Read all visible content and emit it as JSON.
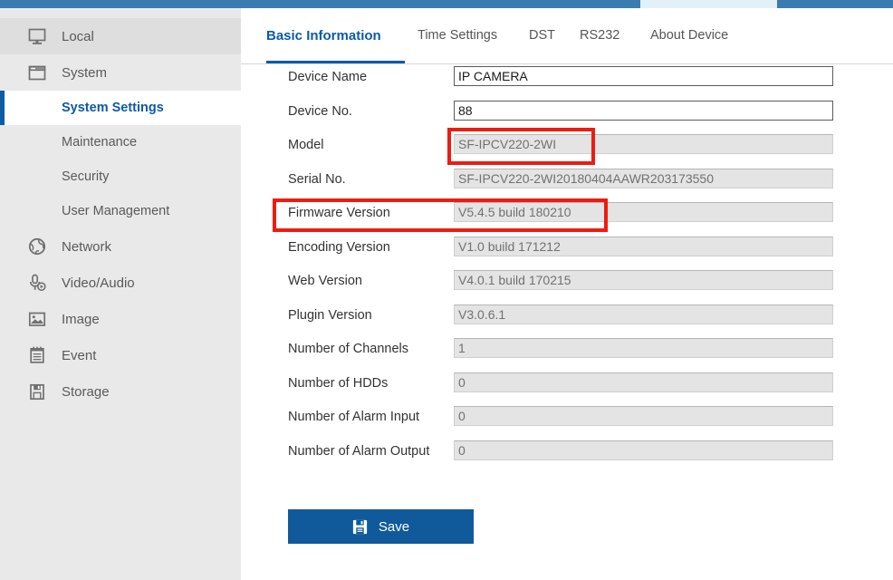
{
  "topbar": {
    "active_tab_placeholder": ""
  },
  "sidebar": {
    "items": [
      {
        "label": "Local",
        "icon": "monitor-icon",
        "level": "top",
        "state": "hover"
      },
      {
        "label": "System",
        "icon": "window-icon",
        "level": "top",
        "state": "expanded"
      },
      {
        "label": "System Settings",
        "icon": "",
        "level": "sub",
        "state": "active"
      },
      {
        "label": "Maintenance",
        "icon": "",
        "level": "sub",
        "state": "normal"
      },
      {
        "label": "Security",
        "icon": "",
        "level": "sub",
        "state": "normal"
      },
      {
        "label": "User Management",
        "icon": "",
        "level": "sub",
        "state": "normal"
      },
      {
        "label": "Network",
        "icon": "globe-icon",
        "level": "top",
        "state": "normal"
      },
      {
        "label": "Video/Audio",
        "icon": "microphone-icon",
        "level": "top",
        "state": "normal"
      },
      {
        "label": "Image",
        "icon": "picture-icon",
        "level": "top",
        "state": "normal"
      },
      {
        "label": "Event",
        "icon": "calendar-icon",
        "level": "top",
        "state": "normal"
      },
      {
        "label": "Storage",
        "icon": "floppy-disk-icon",
        "level": "top",
        "state": "normal"
      }
    ]
  },
  "main": {
    "tabs": [
      {
        "label": "Basic Information",
        "active": true
      },
      {
        "label": "Time Settings",
        "active": false
      },
      {
        "label": "DST",
        "active": false
      },
      {
        "label": "RS232",
        "active": false
      },
      {
        "label": "About Device",
        "active": false
      }
    ],
    "fields": [
      {
        "label": "Device Name",
        "value": "IP CAMERA",
        "readonly": false
      },
      {
        "label": "Device No.",
        "value": "88",
        "readonly": false
      },
      {
        "label": "Model",
        "value": "SF-IPCV220-2WI",
        "readonly": true
      },
      {
        "label": "Serial No.",
        "value": "SF-IPCV220-2WI20180404AAWR203173550",
        "readonly": true
      },
      {
        "label": "Firmware Version",
        "value": "V5.4.5 build 180210",
        "readonly": true
      },
      {
        "label": "Encoding Version",
        "value": "V1.0 build 171212",
        "readonly": true
      },
      {
        "label": "Web Version",
        "value": "V4.0.1 build 170215",
        "readonly": true
      },
      {
        "label": "Plugin Version",
        "value": "V3.0.6.1",
        "readonly": true
      },
      {
        "label": "Number of Channels",
        "value": "1",
        "readonly": true
      },
      {
        "label": "Number of HDDs",
        "value": "0",
        "readonly": true
      },
      {
        "label": "Number of Alarm Input",
        "value": "0",
        "readonly": true
      },
      {
        "label": "Number of Alarm Output",
        "value": "0",
        "readonly": true
      }
    ],
    "save_label": "Save"
  },
  "annotations": [
    {
      "name": "model-highlight",
      "target": "Model"
    },
    {
      "name": "firmware-version-highlight",
      "target": "Firmware Version"
    }
  ],
  "colors": {
    "accent_blue": "#0d5ba5",
    "topbar_blue": "#3b7cb0",
    "save_button_blue": "#105a9c",
    "annotation_red": "#ee1b11",
    "sidebar_bg": "#e9e9e9",
    "readonly_field_bg": "#e4e4e4"
  }
}
